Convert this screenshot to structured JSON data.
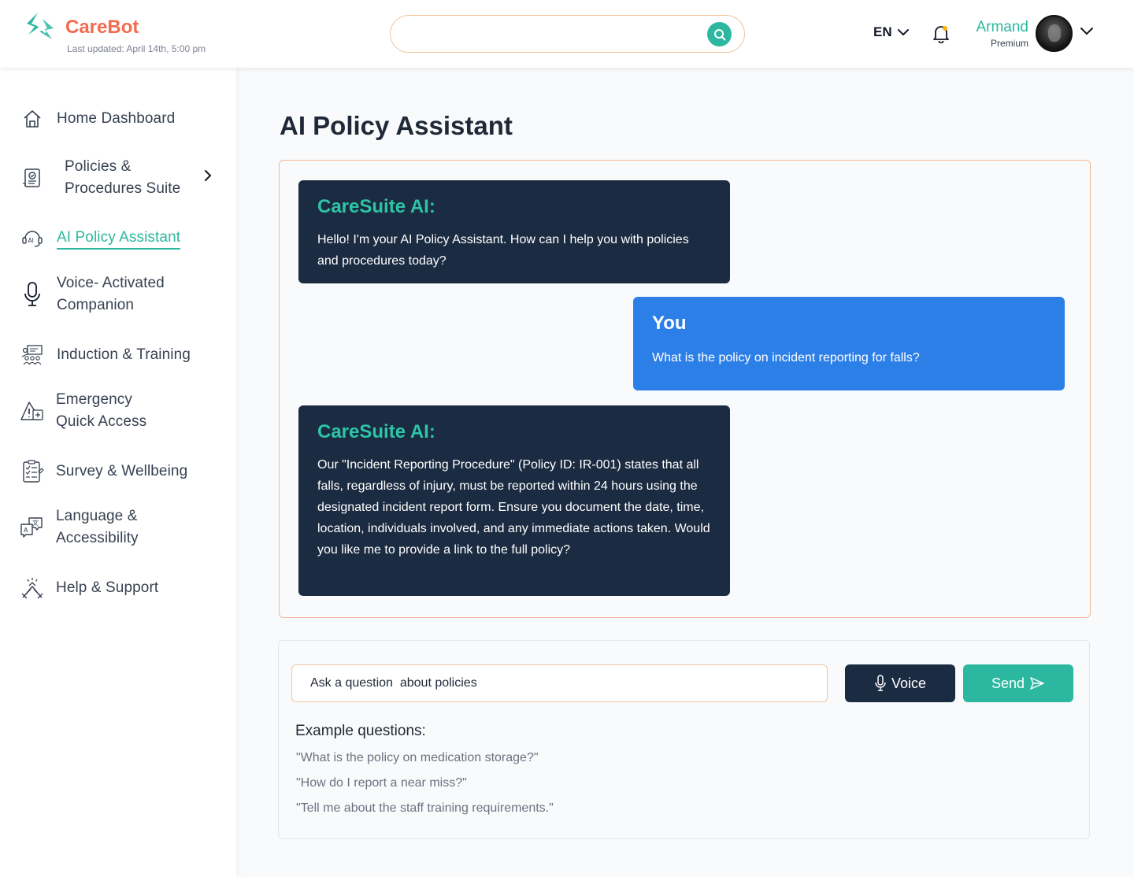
{
  "colors": {
    "brand": "#f26b4f",
    "accent": "#2cb8a0",
    "ai_bubble": "#1b2b41",
    "user_bubble": "#2d7fe8"
  },
  "header": {
    "brand": "CareBot",
    "last_updated": "Last updated:  April 14th, 5:00 pm",
    "search_placeholder": "",
    "language": "EN",
    "user": {
      "name": "Armand",
      "tier": "Premium"
    }
  },
  "sidebar": {
    "items": [
      {
        "icon": "home-icon",
        "lines": [
          "Home Dashboard"
        ]
      },
      {
        "icon": "policy-document-icon",
        "lines": [
          "Policies &",
          "Procedures Suite"
        ]
      },
      {
        "icon": "ai-assistant-icon",
        "lines": [
          "AI Policy Assistant"
        ],
        "active": true
      },
      {
        "icon": "microphone-icon",
        "lines": [
          "Voice- Activated",
          "Companion"
        ]
      },
      {
        "icon": "training-icon",
        "lines": [
          "Induction & Training"
        ]
      },
      {
        "icon": "emergency-icon",
        "lines": [
          "Emergency",
          "Quick Access"
        ]
      },
      {
        "icon": "survey-icon",
        "lines": [
          "Survey & Wellbeing"
        ]
      },
      {
        "icon": "language-icon",
        "lines": [
          "Language &",
          "Accessibility"
        ]
      },
      {
        "icon": "support-icon",
        "lines": [
          "Help & Support"
        ]
      }
    ]
  },
  "main": {
    "title": "AI Policy Assistant",
    "messages": [
      {
        "sender": "CareSuite AI:",
        "text": "Hello! I'm your AI Policy Assistant. How can I help you with policies and procedures today?"
      },
      {
        "sender": "You",
        "text": "What is the policy on incident reporting for falls?"
      },
      {
        "sender": "CareSuite AI:",
        "text": "Our \"Incident Reporting Procedure\" (Policy ID: IR-001) states that all falls, regardless of injury, must be reported within 24 hours using the designated incident report form. Ensure you document the date, time, location, individuals involved, and any immediate actions taken. Would you like me to provide a link to the full policy?"
      }
    ],
    "input_placeholder": "Ask a question  about policies",
    "voice_label": "Voice",
    "send_label": "Send",
    "examples_title": "Example questions:",
    "examples": [
      " \"What is the policy on medication storage?\"",
      "\"How do I report a near miss?\"",
      " \"Tell me about the staff training requirements.\""
    ]
  }
}
